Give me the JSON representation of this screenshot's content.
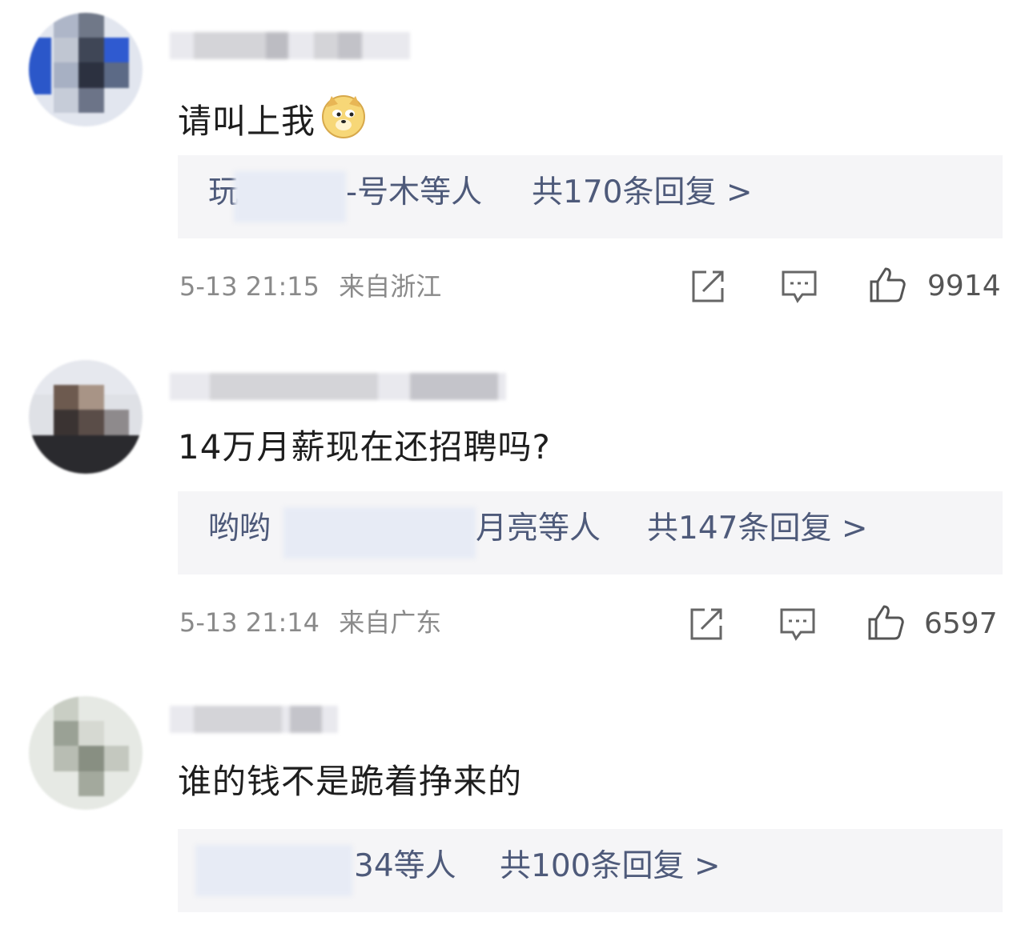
{
  "comments": [
    {
      "text": "请叫上我",
      "emoji": "doge-emoji",
      "reply_prefix": "玩",
      "reply_suffix": "-号木等人",
      "reply_total": "共170条回复 >",
      "time": "5-13 21:15",
      "location": "来自浙江",
      "likes": "9914"
    },
    {
      "text": "14万月薪现在还招聘吗?",
      "reply_prefix": "哟哟",
      "reply_suffix": "月亮等人",
      "reply_total": "共147条回复 >",
      "time": "5-13 21:14",
      "location": "来自广东",
      "likes": "6597"
    },
    {
      "text": "谁的钱不是跪着挣来的",
      "reply_suffix": "34等人",
      "reply_total": "共100条回复 >"
    }
  ],
  "icons": {
    "share": "share-icon",
    "comment": "comment-icon",
    "like": "like-icon"
  },
  "colors": {
    "reply_text": "#4e5a7a",
    "reply_bg": "#f5f5f7",
    "meta": "#8a8a8a"
  }
}
